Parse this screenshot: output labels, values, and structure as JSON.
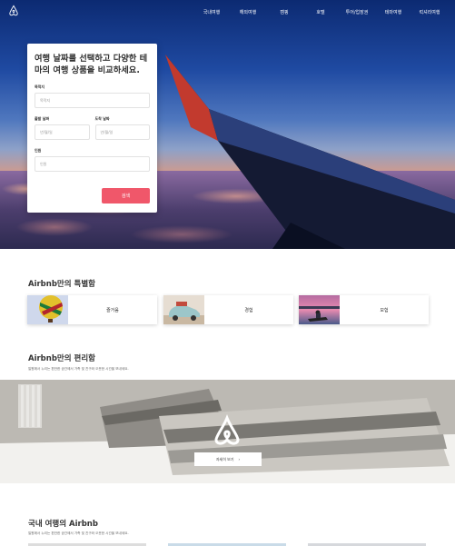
{
  "header": {
    "logo_icon": "airbnb-logo-icon",
    "nav": [
      "국내여행",
      "해외여행",
      "캠핑",
      "호텔",
      "투어/업장권",
      "테마여행",
      "럭셔리여행"
    ]
  },
  "search": {
    "title": "여행 날짜를 선택하고 다양한 테마의 여행 상품을 비교하세요.",
    "destination_label": "목적지",
    "destination_placeholder": "목적지",
    "checkin_label": "출발 날짜",
    "checkin_placeholder": "년/월/일",
    "checkout_label": "도착 날짜",
    "checkout_placeholder": "년/월/일",
    "guests_label": "인원",
    "guests_placeholder": "인원",
    "button": "검색"
  },
  "special": {
    "title": "Airbnb만의 특별함",
    "cards": [
      "즐거움",
      "경험",
      "모험"
    ]
  },
  "convenience": {
    "title": "Airbnb만의 편리함",
    "subtitle": "일원에서 누리는 편안한 공간에서 가족 및 친구와 오붓한 시간을 보내세요.",
    "button": "자세히 보기"
  },
  "domestic": {
    "title": "국내 여행의 Airbnb",
    "subtitle": "일원에서 누리는 편안한 공간에서 가족 및 친구와 오붓한 시간을 보내세요."
  },
  "colors": {
    "accent": "#f0576a"
  }
}
